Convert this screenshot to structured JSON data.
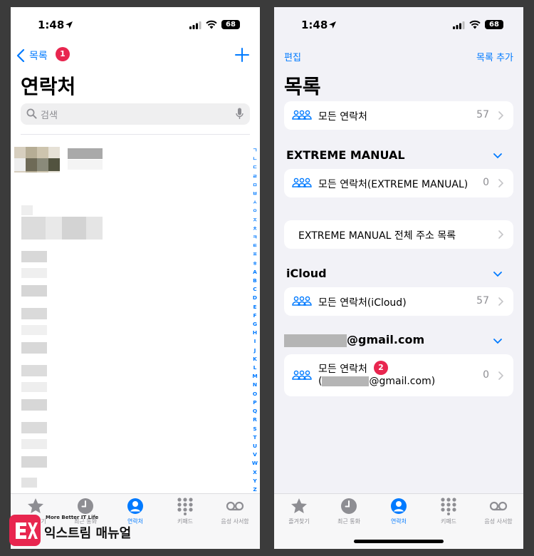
{
  "status": {
    "time": "1:48",
    "battery": "68"
  },
  "left": {
    "nav": {
      "back_label": "목록",
      "badge": "1"
    },
    "title": "연락처",
    "search": {
      "placeholder": "검색"
    },
    "index": [
      "ㄱ",
      "ㄴ",
      "ㄷ",
      "ㄹ",
      "ㅁ",
      "ㅂ",
      "ㅅ",
      "ㅇ",
      "ㅈ",
      "ㅊ",
      "ㅋ",
      "ㅌ",
      "ㅍ",
      "ㅎ",
      "A",
      "B",
      "C",
      "D",
      "E",
      "F",
      "G",
      "H",
      "I",
      "J",
      "K",
      "L",
      "M",
      "N",
      "O",
      "P",
      "Q",
      "R",
      "S",
      "T",
      "U",
      "V",
      "W",
      "X",
      "Y",
      "Z",
      "#"
    ]
  },
  "right": {
    "nav": {
      "edit_label": "편집",
      "add_label": "목록 추가"
    },
    "title": "목록",
    "all_contacts": {
      "label": "모든 연락처",
      "count": "57"
    },
    "sections": {
      "extreme": {
        "header": "EXTREME MANUAL",
        "row_label": "모든 연락처(EXTREME MANUAL)",
        "row_count": "0",
        "directory_label": "EXTREME MANUAL 전체 주소 목록"
      },
      "icloud": {
        "header": "iCloud",
        "row_label": "모든 연락처(iCloud)",
        "row_count": "57"
      },
      "gmail": {
        "header_suffix": "@gmail.com",
        "row_label": "모든 연락처",
        "row_sub_prefix": "(",
        "row_sub_suffix": "@gmail.com)",
        "row_count": "0",
        "badge": "2"
      }
    }
  },
  "tabs": [
    {
      "label": "즐겨찾기",
      "icon": "star-icon"
    },
    {
      "label": "최근 통화",
      "icon": "clock-icon"
    },
    {
      "label": "연락처",
      "icon": "person-circle-icon",
      "active": true
    },
    {
      "label": "키패드",
      "icon": "keypad-icon"
    },
    {
      "label": "음성 사서함",
      "icon": "voicemail-icon"
    }
  ],
  "watermark": {
    "sub": "More Better IT Life",
    "main": "익스트림 매뉴얼",
    "logo": "EX"
  },
  "colors": {
    "accent": "#007aff",
    "badge": "#e8264f",
    "grouped_bg": "#f2f2f7"
  }
}
